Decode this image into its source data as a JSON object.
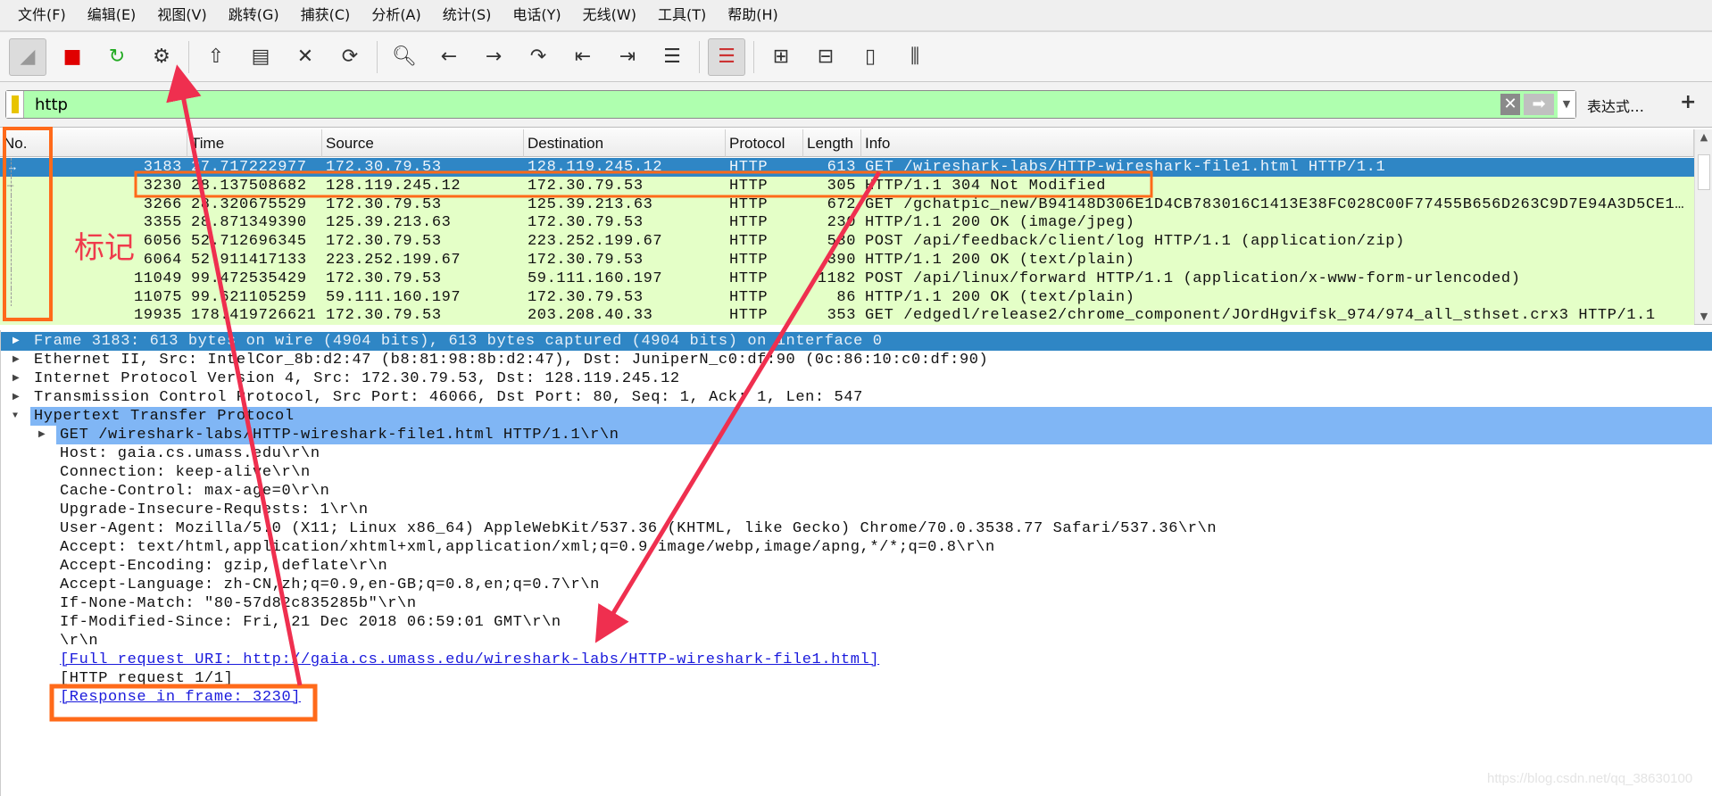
{
  "menu": [
    "文件(F)",
    "编辑(E)",
    "视图(V)",
    "跳转(G)",
    "捕获(C)",
    "分析(A)",
    "统计(S)",
    "电话(Y)",
    "无线(W)",
    "工具(T)",
    "帮助(H)"
  ],
  "toolbar": {
    "icons": [
      "start-capture-icon",
      "stop-capture-icon",
      "restart-capture-icon",
      "capture-options-icon",
      "open-file-icon",
      "save-file-icon",
      "close-file-icon",
      "reload-file-icon",
      "find-packet-icon",
      "go-back-icon",
      "go-forward-icon",
      "go-to-packet-icon",
      "first-packet-icon",
      "last-packet-icon",
      "autoscroll-icon",
      "colorize-icon",
      "zoom-in-icon",
      "zoom-out-icon",
      "normal-size-icon",
      "resize-columns-icon"
    ]
  },
  "filter": {
    "value": "http",
    "expression_label": "表达式…",
    "plus_label": "+",
    "bg_color": "#afffaf"
  },
  "packet_list": {
    "columns": [
      "No.",
      "Time",
      "Source",
      "Destination",
      "Protocol",
      "Length",
      "Info"
    ],
    "rows": [
      {
        "no": "3183",
        "time": "27.717222977",
        "src": "172.30.79.53",
        "dst": "128.119.245.12",
        "proto": "HTTP",
        "len": "613",
        "info": "GET /wireshark-labs/HTTP-wireshark-file1.html HTTP/1.1",
        "selected": true
      },
      {
        "no": "3230",
        "time": "28.137508682",
        "src": "128.119.245.12",
        "dst": "172.30.79.53",
        "proto": "HTTP",
        "len": "305",
        "info": "HTTP/1.1 304 Not Modified"
      },
      {
        "no": "3266",
        "time": "28.320675529",
        "src": "172.30.79.53",
        "dst": "125.39.213.63",
        "proto": "HTTP",
        "len": "672",
        "info": "GET /gchatpic_new/B94148D306E1D4CB783016C1413E38FC028C00F77455B656D263C9D7E94A3D5CE1…"
      },
      {
        "no": "3355",
        "time": "28.871349390",
        "src": "125.39.213.63",
        "dst": "172.30.79.53",
        "proto": "HTTP",
        "len": "230",
        "info": "HTTP/1.1 200 OK  (image/jpeg)"
      },
      {
        "no": "6056",
        "time": "52.712696345",
        "src": "172.30.79.53",
        "dst": "223.252.199.67",
        "proto": "HTTP",
        "len": "530",
        "info": "POST /api/feedback/client/log HTTP/1.1  (application/zip)"
      },
      {
        "no": "6064",
        "time": "52.911417133",
        "src": "223.252.199.67",
        "dst": "172.30.79.53",
        "proto": "HTTP",
        "len": "390",
        "info": "HTTP/1.1 200 OK  (text/plain)"
      },
      {
        "no": "11049",
        "time": "99.472535429",
        "src": "172.30.79.53",
        "dst": "59.111.160.197",
        "proto": "HTTP",
        "len": "1182",
        "info": "POST /api/linux/forward HTTP/1.1  (application/x-www-form-urlencoded)"
      },
      {
        "no": "11075",
        "time": "99.621105259",
        "src": "59.111.160.197",
        "dst": "172.30.79.53",
        "proto": "HTTP",
        "len": "86",
        "info": "HTTP/1.1 200 OK  (text/plain)"
      },
      {
        "no": "19935",
        "time": "178.419726621",
        "src": "172.30.79.53",
        "dst": "203.208.40.33",
        "proto": "HTTP",
        "len": "353",
        "info": "GET /edgedl/release2/chrome_component/JOrdHgvifsk_974/974_all_sthset.crx3 HTTP/1.1"
      }
    ],
    "row_color": "#e4ffc7",
    "selected_color": "#2f86c5"
  },
  "details": [
    {
      "level": 0,
      "arrow": "right",
      "text": "Frame 3183: 613 bytes on wire (4904 bits), 613 bytes captured (4904 bits) on interface 0",
      "style": "selected"
    },
    {
      "level": 0,
      "arrow": "right",
      "text": "Ethernet II, Src: IntelCor_8b:d2:47 (b8:81:98:8b:d2:47), Dst: JuniperN_c0:df:90 (0c:86:10:c0:df:90)"
    },
    {
      "level": 0,
      "arrow": "right",
      "text": "Internet Protocol Version 4, Src: 172.30.79.53, Dst: 128.119.245.12"
    },
    {
      "level": 0,
      "arrow": "right",
      "text": "Transmission Control Protocol, Src Port: 46066, Dst Port: 80, Seq: 1, Ack: 1, Len: 547"
    },
    {
      "level": 0,
      "arrow": "down",
      "text": "Hypertext Transfer Protocol",
      "style": "highlight"
    },
    {
      "level": 1,
      "arrow": "right",
      "text": "GET /wireshark-labs/HTTP-wireshark-file1.html HTTP/1.1\\r\\n",
      "style": "highlight"
    },
    {
      "level": 1,
      "text": "Host: gaia.cs.umass.edu\\r\\n"
    },
    {
      "level": 1,
      "text": "Connection: keep-alive\\r\\n"
    },
    {
      "level": 1,
      "text": "Cache-Control: max-age=0\\r\\n"
    },
    {
      "level": 1,
      "text": "Upgrade-Insecure-Requests: 1\\r\\n"
    },
    {
      "level": 1,
      "text": "User-Agent: Mozilla/5.0 (X11; Linux x86_64) AppleWebKit/537.36 (KHTML, like Gecko) Chrome/70.0.3538.77 Safari/537.36\\r\\n"
    },
    {
      "level": 1,
      "text": "Accept: text/html,application/xhtml+xml,application/xml;q=0.9,image/webp,image/apng,*/*;q=0.8\\r\\n"
    },
    {
      "level": 1,
      "text": "Accept-Encoding: gzip, deflate\\r\\n"
    },
    {
      "level": 1,
      "text": "Accept-Language: zh-CN,zh;q=0.9,en-GB;q=0.8,en;q=0.7\\r\\n"
    },
    {
      "level": 1,
      "text": "If-None-Match: \"80-57d82c835285b\"\\r\\n"
    },
    {
      "level": 1,
      "text": "If-Modified-Since: Fri, 21 Dec 2018 06:59:01 GMT\\r\\n"
    },
    {
      "level": 1,
      "text": "\\r\\n"
    },
    {
      "level": 1,
      "text": "[Full request URI: http://gaia.cs.umass.edu/wireshark-labs/HTTP-wireshark-file1.html]",
      "style": "link"
    },
    {
      "level": 1,
      "text": "[HTTP request 1/1]"
    },
    {
      "level": 1,
      "text": "[Response in frame: 3230]",
      "style": "link"
    }
  ],
  "annotation": {
    "label": "标记",
    "color": "#ef2f4f",
    "box_color": "#ff6a1a"
  },
  "watermark": "https://blog.csdn.net/qq_38630100"
}
